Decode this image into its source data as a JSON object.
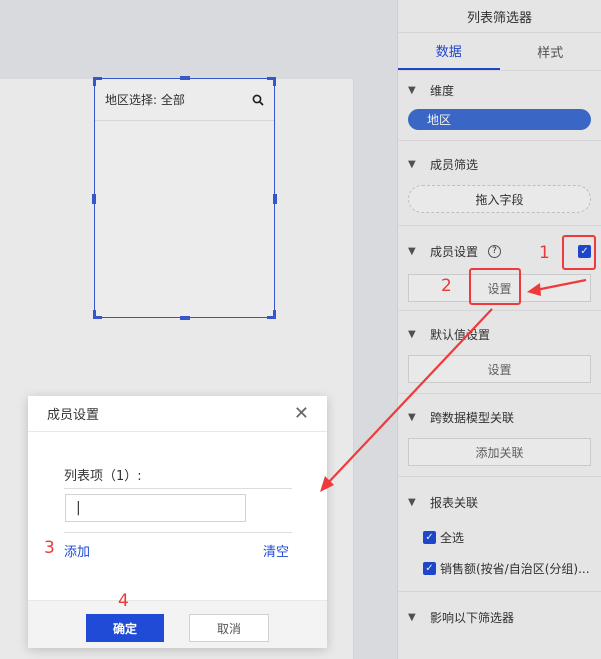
{
  "widget": {
    "label": "地区选择: 全部"
  },
  "panel": {
    "title": "列表筛选器",
    "tabs": [
      "数据",
      "样式"
    ],
    "sections": {
      "dimension": {
        "title": "维度",
        "field": "地区"
      },
      "member_filter": {
        "title": "成员筛选",
        "placeholder": "拖入字段"
      },
      "member_settings": {
        "title": "成员设置",
        "button": "设置"
      },
      "default_value": {
        "title": "默认值设置",
        "button": "设置"
      },
      "cross_model": {
        "title": "跨数据模型关联",
        "button": "添加关联"
      },
      "report_link": {
        "title": "报表关联",
        "items": [
          "全选",
          "销售额(按省/自治区(分组)..."
        ]
      },
      "affect_filters": {
        "title": "影响以下筛选器"
      }
    }
  },
  "dialog": {
    "title": "成员设置",
    "list_label": "列表项（1）:",
    "input_value": "|",
    "add": "添加",
    "clear": "清空",
    "ok": "确定",
    "cancel": "取消"
  },
  "annotations": [
    "1",
    "2",
    "3",
    "4"
  ],
  "colors": {
    "accent": "#1f4bd6",
    "annotation": "#ee3a3a"
  }
}
